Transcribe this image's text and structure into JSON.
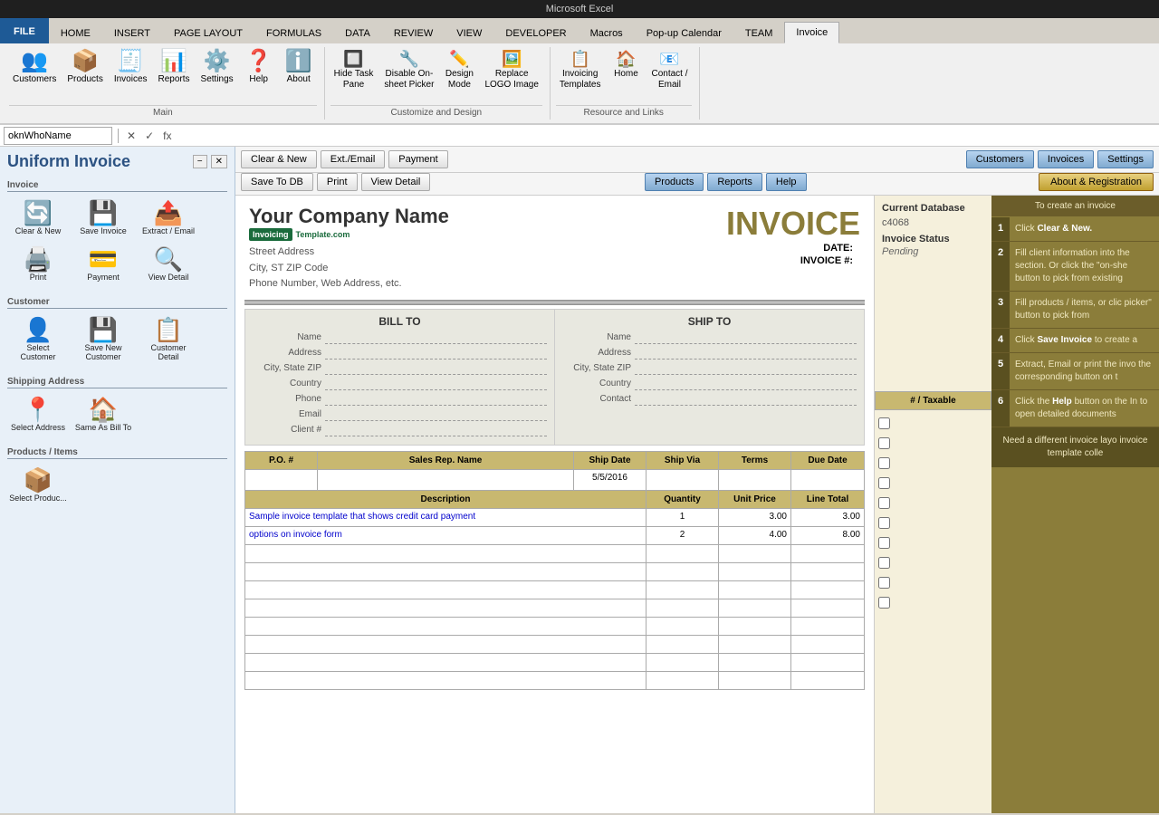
{
  "app": {
    "title": "Microsoft Excel",
    "name_box": "oknWhoName"
  },
  "ribbon": {
    "tabs": [
      "FILE",
      "HOME",
      "INSERT",
      "PAGE LAYOUT",
      "FORMULAS",
      "DATA",
      "REVIEW",
      "VIEW",
      "DEVELOPER",
      "Macros",
      "Pop-up Calendar",
      "TEAM",
      "Invoice"
    ],
    "active_tab": "Invoice",
    "groups": {
      "main": {
        "label": "Main",
        "items": [
          {
            "label": "Customers",
            "icon": "👥"
          },
          {
            "label": "Products",
            "icon": "📦"
          },
          {
            "label": "Invoices",
            "icon": "🧾"
          },
          {
            "label": "Reports",
            "icon": "📊"
          },
          {
            "label": "Settings",
            "icon": "⚙️"
          },
          {
            "label": "Help",
            "icon": "❓"
          },
          {
            "label": "About",
            "icon": "ℹ️"
          }
        ]
      },
      "customize": {
        "label": "Customize and Design",
        "items": [
          {
            "label": "Hide Task Pane",
            "icon": "🔲"
          },
          {
            "label": "Disable On-sheet Picker",
            "icon": "🔧"
          },
          {
            "label": "Design Mode",
            "icon": "✏️"
          },
          {
            "label": "Replace LOGO Image",
            "icon": "🖼️"
          }
        ]
      },
      "resource": {
        "label": "Resource and Links",
        "items": [
          {
            "label": "Invoicing Templates",
            "icon": "📋"
          },
          {
            "label": "Home",
            "icon": "🏠"
          },
          {
            "label": "Contact / Email",
            "icon": "📧"
          }
        ]
      }
    }
  },
  "toolbar": {
    "buttons": [
      {
        "label": "Clear & New",
        "style": "normal"
      },
      {
        "label": "Ext./Email",
        "style": "normal"
      },
      {
        "label": "Payment",
        "style": "normal"
      },
      {
        "label": "Save To DB",
        "style": "normal"
      },
      {
        "label": "Print",
        "style": "normal"
      },
      {
        "label": "View Detail",
        "style": "normal"
      },
      {
        "label": "Customers",
        "style": "blue"
      },
      {
        "label": "Products",
        "style": "blue"
      },
      {
        "label": "Reports",
        "style": "blue"
      },
      {
        "label": "Invoices",
        "style": "blue"
      },
      {
        "label": "Settings",
        "style": "blue"
      },
      {
        "label": "Help",
        "style": "blue"
      },
      {
        "label": "About & Registration",
        "style": "about"
      }
    ]
  },
  "sidebar": {
    "title": "Uniform Invoice",
    "sections": {
      "invoice": {
        "label": "Invoice",
        "items": [
          {
            "label": "Clear & New",
            "icon": "🔄"
          },
          {
            "label": "Save Invoice",
            "icon": "💾"
          },
          {
            "label": "Extract / Email",
            "icon": "📤"
          },
          {
            "label": "Print",
            "icon": "🖨️"
          },
          {
            "label": "Payment",
            "icon": "💳"
          },
          {
            "label": "View Detail",
            "icon": "🔍"
          }
        ]
      },
      "customer": {
        "label": "Customer",
        "items": [
          {
            "label": "Select Customer",
            "icon": "👤"
          },
          {
            "label": "Save New Customer",
            "icon": "💾"
          },
          {
            "label": "Customer Detail",
            "icon": "📋"
          }
        ]
      },
      "shipping": {
        "label": "Shipping Address",
        "items": [
          {
            "label": "Select Address",
            "icon": "📍"
          },
          {
            "label": "Same As Bill To",
            "icon": "🏠"
          }
        ]
      },
      "products": {
        "label": "Products / Items",
        "items": [
          {
            "label": "Select Produc...",
            "icon": "📦"
          }
        ]
      }
    }
  },
  "invoice": {
    "company_name": "Your Company Name",
    "title": "INVOICE",
    "logo_line1": "Invoicing",
    "logo_line2": "Template.com",
    "address": {
      "street": "Street Address",
      "city_state_zip": "City, ST  ZIP Code",
      "phone_web": "Phone Number, Web Address, etc."
    },
    "date_label": "DATE:",
    "invoice_num_label": "INVOICE #:",
    "date_value": "",
    "invoice_num_value": "",
    "bill_to": {
      "title": "BILL TO",
      "name": "",
      "address": "",
      "city_state_zip": "",
      "country": "",
      "phone": "",
      "email": "",
      "client_num": ""
    },
    "ship_to": {
      "title": "SHIP TO",
      "name": "",
      "address": "",
      "city_state_zip": "",
      "country": "",
      "contact": ""
    },
    "po_columns": [
      "P.O. #",
      "Sales Rep. Name",
      "Ship Date",
      "Ship Via",
      "Terms",
      "Due Date"
    ],
    "po_values": [
      "",
      "",
      "5/5/2016",
      "",
      "",
      ""
    ],
    "item_columns": [
      "Description",
      "Quantity",
      "Unit Price",
      "Line Total"
    ],
    "items": [
      {
        "description": "Sample invoice template that shows credit card payment",
        "quantity": "1",
        "unit_price": "3.00",
        "line_total": "3.00"
      },
      {
        "description": "options on invoice form",
        "quantity": "2",
        "unit_price": "4.00",
        "line_total": "8.00"
      },
      {
        "description": "",
        "quantity": "",
        "unit_price": "",
        "line_total": ""
      },
      {
        "description": "",
        "quantity": "",
        "unit_price": "",
        "line_total": ""
      },
      {
        "description": "",
        "quantity": "",
        "unit_price": "",
        "line_total": ""
      },
      {
        "description": "",
        "quantity": "",
        "unit_price": "",
        "line_total": ""
      },
      {
        "description": "",
        "quantity": "",
        "unit_price": "",
        "line_total": ""
      },
      {
        "description": "",
        "quantity": "",
        "unit_price": "",
        "line_total": ""
      },
      {
        "description": "",
        "quantity": "",
        "unit_price": "",
        "line_total": ""
      },
      {
        "description": "",
        "quantity": "",
        "unit_price": "",
        "line_total": ""
      }
    ]
  },
  "right_panel": {
    "db_label": "Current Database",
    "db_value": "c4068",
    "status_label": "Invoice Status",
    "status_value": "Pending",
    "taxable_header": "# / Taxable"
  },
  "instructions": {
    "header": "To create an invoice",
    "steps": [
      {
        "num": "1",
        "text": "Click <strong>Clear & New.</strong>"
      },
      {
        "num": "2",
        "text": "Fill client information into the section. Or click the \"on-she button to pick from existing"
      },
      {
        "num": "3",
        "text": "Fill products / items, or clic picker\" button to pick from"
      },
      {
        "num": "4",
        "text": "Click <strong>Save Invoice</strong> to create a"
      },
      {
        "num": "5",
        "text": "Extract, Email or print the invo the corresponding button on t"
      },
      {
        "num": "6",
        "text": "Click the <strong>Help</strong> button on the In to open detailed documents"
      }
    ],
    "footer": "Need a different invoice layo invoice template colle"
  }
}
